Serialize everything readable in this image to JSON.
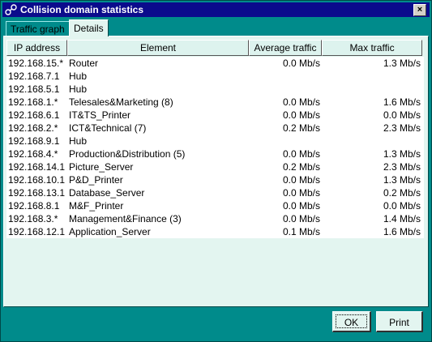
{
  "window": {
    "title": "Collision domain statistics",
    "close_label": "×"
  },
  "tabs": [
    {
      "label": "Traffic graph"
    },
    {
      "label": "Details"
    }
  ],
  "table": {
    "columns": [
      "IP address",
      "Element",
      "Average traffic",
      "Max traffic"
    ],
    "rows": [
      {
        "ip": "192.168.15.*",
        "element": "Router",
        "avg": "0.0 Mb/s",
        "max": "1.3 Mb/s"
      },
      {
        "ip": "192.168.7.1",
        "element": "Hub",
        "avg": "",
        "max": ""
      },
      {
        "ip": "192.168.5.1",
        "element": "Hub",
        "avg": "",
        "max": ""
      },
      {
        "ip": "192.168.1.*",
        "element": "Telesales&Marketing (8)",
        "avg": "0.0 Mb/s",
        "max": "1.6 Mb/s"
      },
      {
        "ip": "192.168.6.1",
        "element": "IT&TS_Printer",
        "avg": "0.0 Mb/s",
        "max": "0.0 Mb/s"
      },
      {
        "ip": "192.168.2.*",
        "element": "ICT&Technical (7)",
        "avg": "0.2 Mb/s",
        "max": "2.3 Mb/s"
      },
      {
        "ip": "192.168.9.1",
        "element": "Hub",
        "avg": "",
        "max": ""
      },
      {
        "ip": "192.168.4.*",
        "element": "Production&Distribution (5)",
        "avg": "0.0 Mb/s",
        "max": "1.3 Mb/s"
      },
      {
        "ip": "192.168.14.1",
        "element": "Picture_Server",
        "avg": "0.2 Mb/s",
        "max": "2.3 Mb/s"
      },
      {
        "ip": "192.168.10.1",
        "element": "P&D_Printer",
        "avg": "0.0 Mb/s",
        "max": "1.3 Mb/s"
      },
      {
        "ip": "192.168.13.1",
        "element": "Database_Server",
        "avg": "0.0 Mb/s",
        "max": "0.2 Mb/s"
      },
      {
        "ip": "192.168.8.1",
        "element": "M&F_Printer",
        "avg": "0.0 Mb/s",
        "max": "0.0 Mb/s"
      },
      {
        "ip": "192.168.3.*",
        "element": "Management&Finance (3)",
        "avg": "0.0 Mb/s",
        "max": "1.4 Mb/s"
      },
      {
        "ip": "192.168.12.1",
        "element": "Application_Server",
        "avg": "0.1 Mb/s",
        "max": "1.6 Mb/s"
      }
    ]
  },
  "buttons": {
    "ok_label": "OK",
    "print_label": "Print"
  },
  "icons": {
    "app": "network-nodes-icon",
    "close": "close-icon"
  },
  "colors": {
    "window_bg": "#008b8b",
    "titlebar": "#0b0b8c",
    "panel": "#e3f5f0"
  }
}
